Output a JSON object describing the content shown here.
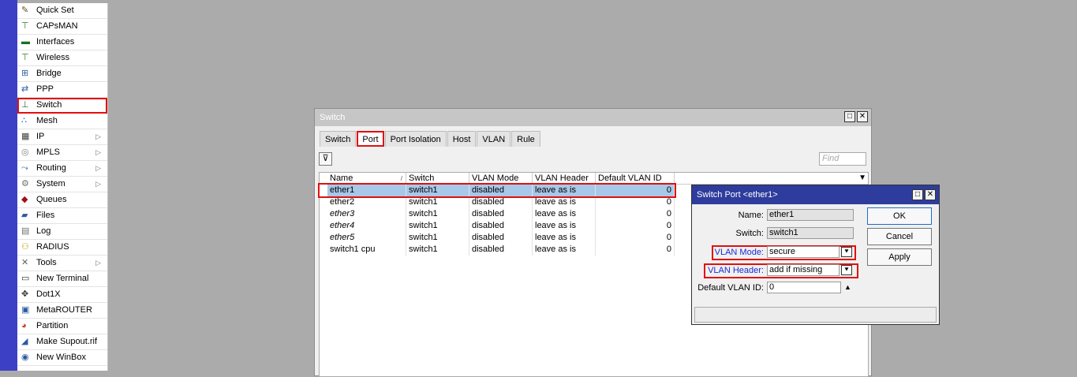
{
  "menu": {
    "items": [
      {
        "label": "Quick Set",
        "icon": "wand-icon",
        "arrow": false
      },
      {
        "label": "CAPsMAN",
        "icon": "wireless-ap-icon",
        "arrow": false
      },
      {
        "label": "Interfaces",
        "icon": "interfaces-icon",
        "arrow": false
      },
      {
        "label": "Wireless",
        "icon": "wireless-icon",
        "arrow": false
      },
      {
        "label": "Bridge",
        "icon": "bridge-icon",
        "arrow": false
      },
      {
        "label": "PPP",
        "icon": "ppp-icon",
        "arrow": false
      },
      {
        "label": "Switch",
        "icon": "switch-icon",
        "arrow": false,
        "highlighted": true
      },
      {
        "label": "Mesh",
        "icon": "mesh-icon",
        "arrow": false
      },
      {
        "label": "IP",
        "icon": "ip-icon",
        "arrow": true
      },
      {
        "label": "MPLS",
        "icon": "mpls-icon",
        "arrow": true
      },
      {
        "label": "Routing",
        "icon": "routing-icon",
        "arrow": true
      },
      {
        "label": "System",
        "icon": "gear-icon",
        "arrow": true
      },
      {
        "label": "Queues",
        "icon": "queues-icon",
        "arrow": false
      },
      {
        "label": "Files",
        "icon": "folder-icon",
        "arrow": false
      },
      {
        "label": "Log",
        "icon": "log-icon",
        "arrow": false
      },
      {
        "label": "RADIUS",
        "icon": "radius-icon",
        "arrow": false
      },
      {
        "label": "Tools",
        "icon": "tools-icon",
        "arrow": true
      },
      {
        "label": "New Terminal",
        "icon": "terminal-icon",
        "arrow": false
      },
      {
        "label": "Dot1X",
        "icon": "dot1x-icon",
        "arrow": false
      },
      {
        "label": "MetaROUTER",
        "icon": "metarouter-icon",
        "arrow": false
      },
      {
        "label": "Partition",
        "icon": "partition-icon",
        "arrow": false
      },
      {
        "label": "Make Supout.rif",
        "icon": "supout-icon",
        "arrow": false
      },
      {
        "label": "New WinBox",
        "icon": "winbox-icon",
        "arrow": false
      }
    ],
    "submenu_arrow": "▷"
  },
  "switch_window": {
    "title": "Switch",
    "tabs": [
      "Switch",
      "Port",
      "Port Isolation",
      "Host",
      "VLAN",
      "Rule"
    ],
    "active_tab": "Port",
    "find_placeholder": "Find",
    "filter_glyph": "⊽",
    "window_buttons": [
      "□",
      "✕"
    ],
    "columns": [
      "Name",
      "Switch",
      "VLAN Mode",
      "VLAN Header",
      "Default VLAN ID"
    ],
    "sort_glyph": "/",
    "dropdown_glyph": "▼",
    "rows": [
      {
        "name": "ether1",
        "switch": "switch1",
        "vlan_mode": "disabled",
        "vlan_header": "leave as is",
        "default_vlan_id": "0",
        "selected": true,
        "italic": false
      },
      {
        "name": "ether2",
        "switch": "switch1",
        "vlan_mode": "disabled",
        "vlan_header": "leave as is",
        "default_vlan_id": "0",
        "selected": false,
        "italic": false
      },
      {
        "name": "ether3",
        "switch": "switch1",
        "vlan_mode": "disabled",
        "vlan_header": "leave as is",
        "default_vlan_id": "0",
        "selected": false,
        "italic": true
      },
      {
        "name": "ether4",
        "switch": "switch1",
        "vlan_mode": "disabled",
        "vlan_header": "leave as is",
        "default_vlan_id": "0",
        "selected": false,
        "italic": true
      },
      {
        "name": "ether5",
        "switch": "switch1",
        "vlan_mode": "disabled",
        "vlan_header": "leave as is",
        "default_vlan_id": "0",
        "selected": false,
        "italic": true
      },
      {
        "name": "switch1 cpu",
        "switch": "switch1",
        "vlan_mode": "disabled",
        "vlan_header": "leave as is",
        "default_vlan_id": "0",
        "selected": false,
        "italic": false
      }
    ]
  },
  "port_dialog": {
    "title": "Switch Port <ether1>",
    "window_buttons": [
      "□",
      "✕"
    ],
    "name_label": "Name:",
    "name_value": "ether1",
    "switch_label": "Switch:",
    "switch_value": "switch1",
    "vlan_mode_label": "VLAN Mode:",
    "vlan_mode_value": "secure",
    "vlan_header_label": "VLAN Header:",
    "vlan_header_value": "add if missing",
    "default_vlan_label": "Default VLAN ID:",
    "default_vlan_value": "0",
    "select_arrow": "⯆",
    "spin_up": "▲",
    "ok_label": "OK",
    "cancel_label": "Cancel",
    "apply_label": "Apply",
    "label_color": "#1a2bd6"
  },
  "colors": {
    "desktop": "#ababab",
    "strip": "#3c40c4",
    "highlight": "#e01010",
    "selection": "#a7c8e8",
    "dialog_title": "#2e3c9d"
  }
}
